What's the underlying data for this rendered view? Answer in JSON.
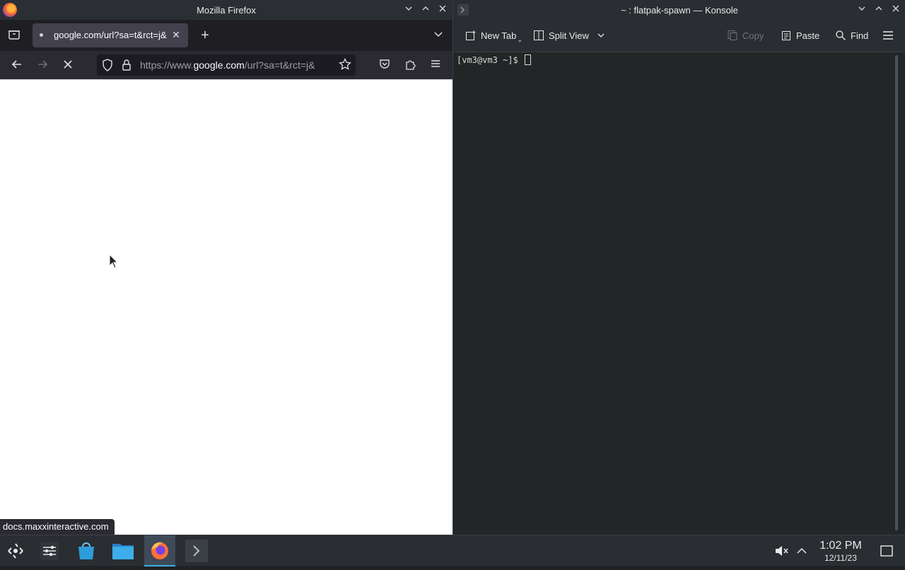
{
  "firefox": {
    "title": "Mozilla Firefox",
    "tab_label": "google.com/url?sa=t&rct=j&",
    "url_prefix": "https://www.",
    "url_domain": "google.com",
    "url_suffix": "/url?sa=t&rct=j&",
    "status_link": "docs.maxxinteractive.com",
    "page_state": "loading"
  },
  "konsole": {
    "title": "~ : flatpak-spawn — Konsole",
    "toolbar": {
      "new_tab": "New Tab",
      "split_view": "Split View",
      "copy": "Copy",
      "paste": "Paste",
      "find": "Find"
    },
    "prompt": "[vm3@vm3 ~]$ "
  },
  "taskbar": {
    "apps": [
      "application-launcher",
      "system-settings",
      "discover",
      "file-manager",
      "firefox",
      "konsole"
    ],
    "active_app": "firefox",
    "time": "1:02 PM",
    "date": "12/11/23",
    "volume_state": "muted"
  },
  "colors": {
    "accent": "#3daee9",
    "konsole_bg": "#232627",
    "firefox_chrome": "#2b2a33"
  }
}
